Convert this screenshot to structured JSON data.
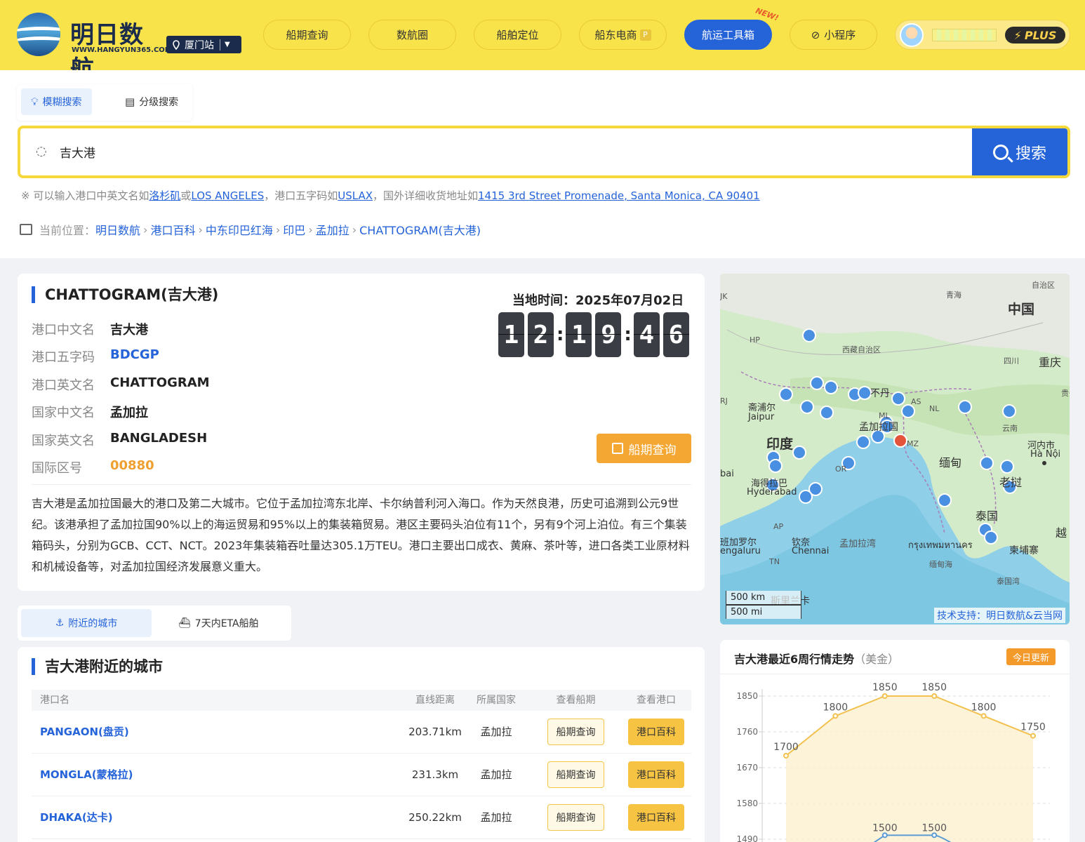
{
  "header": {
    "logo_title": "明日数航",
    "logo_url": "WWW.HANGYUN365.COM",
    "station": "厦门站",
    "nav": [
      {
        "label": "船期查询"
      },
      {
        "label": "数航圈"
      },
      {
        "label": "船舶定位"
      },
      {
        "label": "船东电商",
        "badge": "P"
      },
      {
        "label": "航运工具箱",
        "active": true
      },
      {
        "label": "小程序"
      }
    ],
    "new_tag": "NEW!",
    "plus_label": "PLUS"
  },
  "search": {
    "tabs": [
      {
        "label": "模糊搜索",
        "active": true
      },
      {
        "label": "分级搜索"
      }
    ],
    "query": "吉大港",
    "button_label": "搜索",
    "hint_prefix": "※ 可以输入港口中英文名如",
    "hint_link1": "洛杉矶",
    "hint_or": "或",
    "hint_link2": "LOS ANGELES",
    "hint_mid": "，港口五字码如",
    "hint_link3": "USLAX",
    "hint_mid2": "，国外详细收货地址如",
    "hint_link4": "1415 3rd Street Promenade, Santa Monica, CA 90401"
  },
  "breadcrumb": {
    "label": "当前位置：",
    "items": [
      "明日数航",
      "港口百科",
      "中东印巴红海",
      "印巴",
      "孟加拉",
      "CHATTOGRAM(吉大港)"
    ]
  },
  "port": {
    "title": "CHATTOGRAM(吉大港)",
    "fields": [
      {
        "label": "港口中文名",
        "value": "吉大港"
      },
      {
        "label": "港口五字码",
        "value": "BDCGP"
      },
      {
        "label": "港口英文名",
        "value": "CHATTOGRAM"
      },
      {
        "label": "国家中文名",
        "value": "孟加拉"
      },
      {
        "label": "国家英文名",
        "value": "BANGLADESH"
      },
      {
        "label": "国际区号",
        "value": "00880"
      }
    ],
    "local_time_label": "当地时间：2025年07月02日",
    "time_digits": [
      "1",
      "2",
      "1",
      "9",
      "4",
      "6"
    ],
    "ship_query_label": "船期查询",
    "description": "吉大港是孟加拉国最大的港口及第二大城市。它位于孟加拉湾东北岸、卡尔纳普利河入海口。作为天然良港，历史可追溯到公元9世纪。该港承担了孟加拉国90%以上的海运贸易和95%以上的集装箱贸易。港区主要码头泊位有11个，另有9个河上泊位。有三个集装箱码头，分别为GCB、CCT、NCT。2023年集装箱吞吐量达305.1万TEU。港口主要出口成衣、黄麻、茶叶等，进口各类工业原材料和机械设备等，对孟加拉国经济发展意义重大。"
  },
  "map": {
    "labels": {
      "china": "中国",
      "tibet": "西藏自治区",
      "qinghai": "青海",
      "sichuan": "四川",
      "chongqing": "重庆",
      "yunnan": "云南",
      "guizhou": "贵州",
      "india": "印度",
      "jaipur_cn": "斋浦尔",
      "jaipur": "Jaipur",
      "hyderabad_cn": "海得拉巴",
      "hyderabad": "Hyderabad",
      "chennai_cn": "钦奈",
      "chennai": "Chennai",
      "bengaluru_cn": "班加罗尔",
      "bengaluru": "engaluru",
      "bay": "孟加拉湾",
      "myanmar": "缅甸",
      "thailand": "泰国",
      "laos": "老挝",
      "hanoi_cn": "河内市",
      "hanoi": "Hà Nội",
      "bangkok": "กรุงเทพมหานคร",
      "cambodia": "柬埔寨",
      "viet": "越",
      "srilanka": "斯里兰卡",
      "bangladesh": "孟加拉国",
      "bhutan": "不丹",
      "gulf_thai": "泰国湾",
      "andaman": "缅甸海",
      "bai": "bai",
      "hp": "HP",
      "rj": "RJ",
      "tn": "TN",
      "ap": "AP",
      "or": "OR",
      "nl": "NL",
      "mz": "MZ",
      "ml": "ML",
      "as": "AS",
      "jk": "JK",
      "autonomous": "自治区"
    },
    "scale_km": "500 km",
    "scale_mi": "500 mi",
    "credit": "技术支持：明日数航&云当网"
  },
  "sub_tabs": [
    {
      "label": "附近的城市",
      "active": true
    },
    {
      "label": "7天内ETA船舶"
    }
  ],
  "nearby": {
    "title": "吉大港附近的城市",
    "columns": [
      "港口名",
      "直线距离",
      "所属国家",
      "查看船期",
      "查看港口"
    ],
    "rows": [
      {
        "name": "PANGAON(盘贡)",
        "distance": "203.71km",
        "country": "孟加拉",
        "ship_btn": "船期查询",
        "port_btn": "港口百科"
      },
      {
        "name": "MONGLA(蒙格拉)",
        "distance": "231.3km",
        "country": "孟加拉",
        "ship_btn": "船期查询",
        "port_btn": "港口百科"
      },
      {
        "name": "DHAKA(达卡)",
        "distance": "250.22km",
        "country": "孟加拉",
        "ship_btn": "船期查询",
        "port_btn": "港口百科"
      }
    ]
  },
  "trend": {
    "title": "吉大港最近6周行情走势",
    "unit": "（美金）",
    "badge": "今日更新"
  },
  "chart_data": {
    "type": "line",
    "title": "吉大港最近6周行情走势",
    "yticks": [
      1850,
      1760,
      1670,
      1580,
      1490
    ],
    "ylim": [
      1490,
      1850
    ],
    "grid": true,
    "series": [
      {
        "values": [
          1700,
          1800,
          1850,
          1850,
          1800,
          1750
        ],
        "color": "#f2c14e"
      },
      {
        "values": [
          1500,
          1500
        ],
        "color": "#5b9bd5"
      }
    ]
  },
  "colors": {
    "brand_yellow": "#f9e34a",
    "accent_blue": "#2563d9",
    "orange": "#f4a733"
  }
}
